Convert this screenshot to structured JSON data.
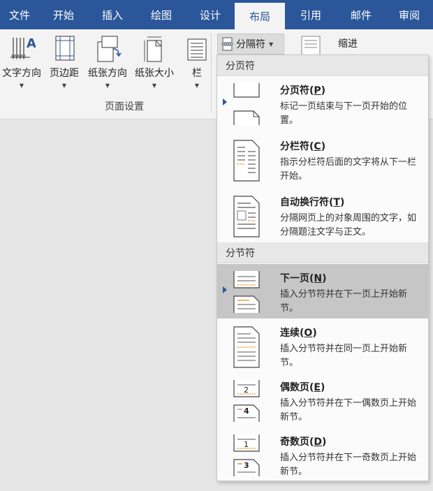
{
  "tabs": [
    {
      "label": "文件",
      "active": false
    },
    {
      "label": "开始",
      "active": false
    },
    {
      "label": "插入",
      "active": false
    },
    {
      "label": "绘图",
      "active": false
    },
    {
      "label": "设计",
      "active": false
    },
    {
      "label": "布局",
      "active": true
    },
    {
      "label": "引用",
      "active": false
    },
    {
      "label": "邮件",
      "active": false
    },
    {
      "label": "审阅",
      "active": false
    }
  ],
  "ribbon": {
    "buttons": [
      {
        "label": "文字方向",
        "icon": "text-direction-icon"
      },
      {
        "label": "页边距",
        "icon": "margins-icon"
      },
      {
        "label": "纸张方向",
        "icon": "orientation-icon"
      },
      {
        "label": "纸张大小",
        "icon": "paper-size-icon"
      },
      {
        "label": "栏",
        "icon": "columns-icon"
      }
    ],
    "group_label": "页面设置",
    "breaks_label": "分隔符",
    "indent_label": "缩进"
  },
  "menu": {
    "page_breaks_header": "分页符",
    "section_breaks_header": "分节符",
    "items": [
      {
        "title": "分页符",
        "key": "P",
        "desc": "标记一页结束与下一页开始的位置。",
        "icon": "page-break-icon"
      },
      {
        "title": "分栏符",
        "key": "C",
        "desc": "指示分栏符后面的文字将从下一栏开始。",
        "icon": "column-break-icon"
      },
      {
        "title": "自动换行符",
        "key": "T",
        "desc": "分隔网页上的对象周围的文字，如分隔题注文字与正文。",
        "icon": "text-wrapping-break-icon"
      },
      {
        "title": "下一页",
        "key": "N",
        "desc": "插入分节符并在下一页上开始新节。",
        "icon": "next-page-break-icon"
      },
      {
        "title": "连续",
        "key": "O",
        "desc": "插入分节符并在同一页上开始新节。",
        "icon": "continuous-break-icon"
      },
      {
        "title": "偶数页",
        "key": "E",
        "desc": "插入分节符并在下一偶数页上开始新节。",
        "icon": "even-page-break-icon"
      },
      {
        "title": "奇数页",
        "key": "D",
        "desc": "插入分节符并在下一奇数页上开始新节。",
        "icon": "odd-page-break-icon"
      }
    ],
    "even_icon_numbers": [
      "2",
      "4"
    ],
    "odd_icon_numbers": [
      "1",
      "3"
    ]
  },
  "colors": {
    "tabbar": "#2b579a",
    "ribbon": "#f3f3f3",
    "highlight": "#c6c6c6",
    "accent_orange": "#e8a23a"
  }
}
